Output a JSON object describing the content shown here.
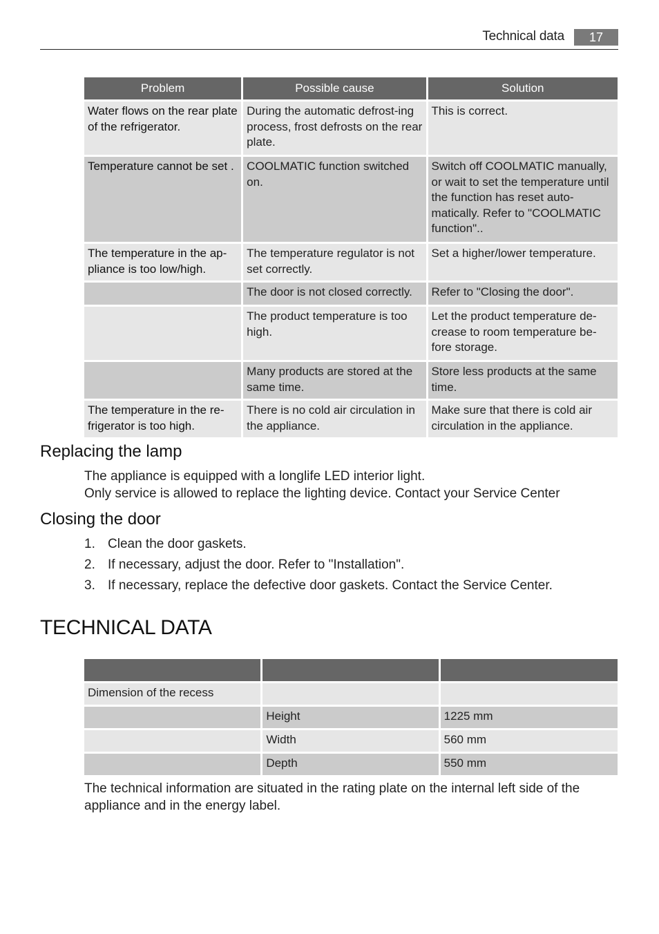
{
  "header": {
    "section_title": "Technical data",
    "page_number": "17"
  },
  "troubleshooting_table": {
    "columns": [
      "Problem",
      "Possible cause",
      "Solution"
    ],
    "rows": [
      {
        "problem": "Water flows on the rear plate of the refrigerator.",
        "cause": "During the automatic defrost-ing process, frost defrosts on the rear plate.",
        "solution": "This is correct."
      },
      {
        "problem": "Temperature cannot be set .",
        "cause": "COOLMATIC function switched on.",
        "solution": "Switch off COOLMATIC manually, or wait to set the temperature until the function has reset auto-matically. Refer to \"COOLMATIC function\".."
      },
      {
        "problem": "The temperature in the ap-pliance is too low/high.",
        "cause": "The temperature regulator is not set correctly.",
        "solution": "Set a higher/lower temperature."
      },
      {
        "problem": "",
        "cause": "The door is not closed correctly.",
        "solution": "Refer to \"Closing the door\"."
      },
      {
        "problem": "",
        "cause": "The product temperature is too high.",
        "solution": "Let the product temperature de-crease to room temperature be-fore storage."
      },
      {
        "problem": "",
        "cause": "Many products are stored at the same time.",
        "solution": "Store less products at the same time."
      },
      {
        "problem": "The temperature in the re-frigerator is too high.",
        "cause": "There is no cold air circulation in the appliance.",
        "solution": "Make sure that there is cold air circulation in the appliance."
      }
    ]
  },
  "replacing_lamp": {
    "heading": "Replacing the lamp",
    "lines": [
      "The appliance is equipped with a longlife LED interior light.",
      "Only service is allowed to replace the lighting device. Contact your Service Center"
    ]
  },
  "closing_door": {
    "heading": "Closing the door",
    "steps": [
      {
        "num": "1.",
        "text": "Clean the door gaskets."
      },
      {
        "num": "2.",
        "text": "If necessary, adjust the door. Refer to \"Installation\"."
      },
      {
        "num": "3.",
        "text": "If necessary, replace the defective door gaskets. Contact the Service Center."
      }
    ]
  },
  "technical_data": {
    "heading": "TECHNICAL DATA",
    "columns": [
      "",
      "",
      ""
    ],
    "rows": [
      {
        "label": "Dimension of the recess",
        "property": "",
        "value": ""
      },
      {
        "label": "",
        "property": "Height",
        "value": "1225 mm"
      },
      {
        "label": "",
        "property": "Width",
        "value": "560 mm"
      },
      {
        "label": "",
        "property": "Depth",
        "value": "550 mm"
      }
    ],
    "note": "The technical information are situated in the rating plate on the internal left side of the appliance and in the energy label."
  }
}
